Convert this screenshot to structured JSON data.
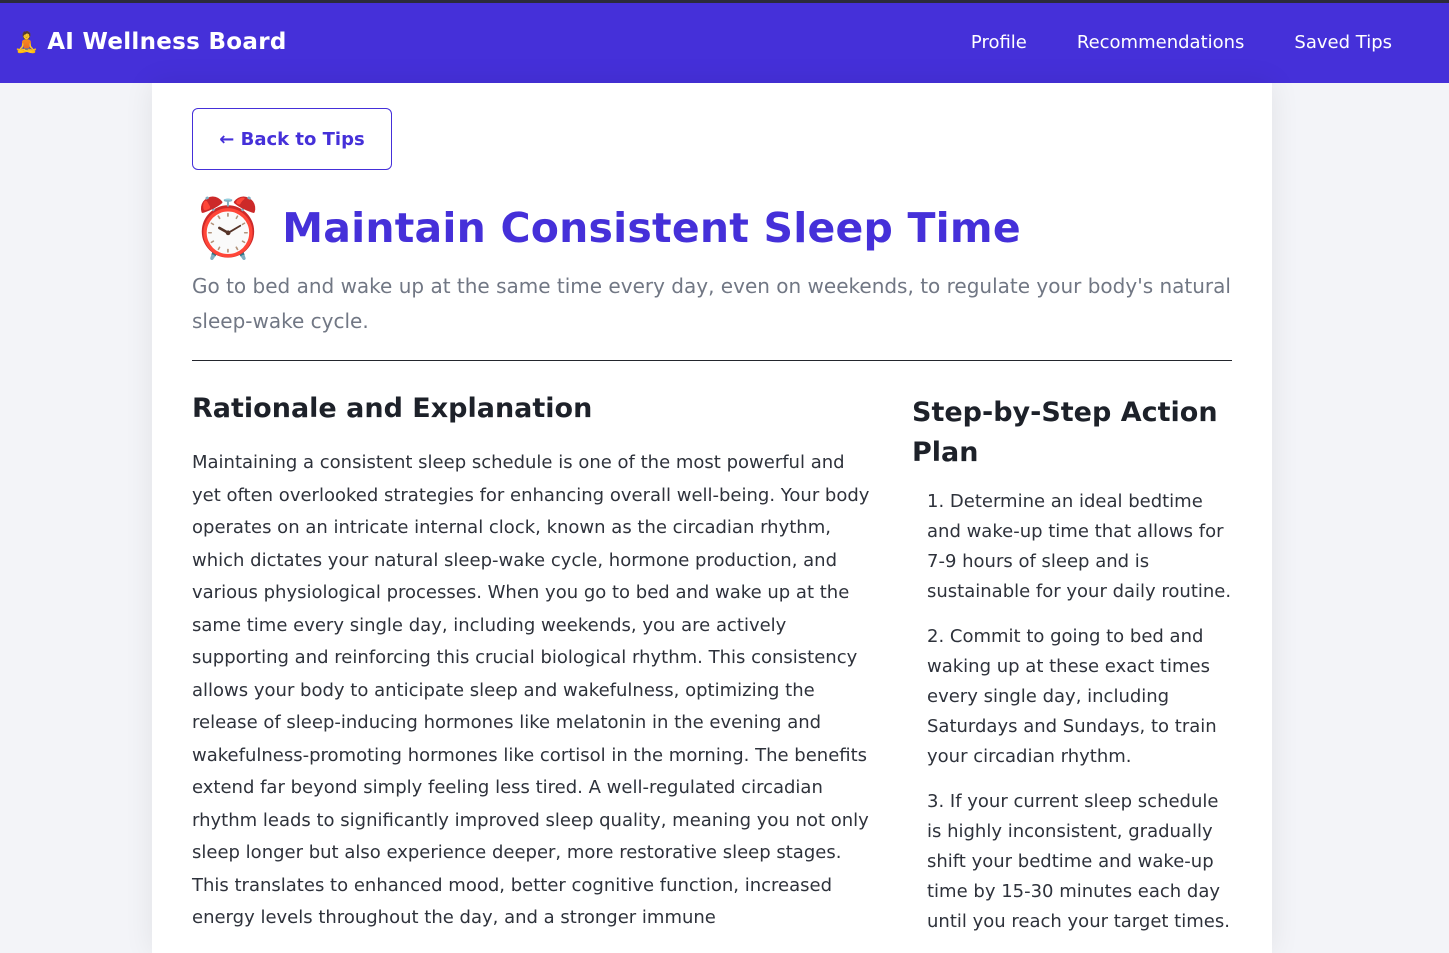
{
  "navbar": {
    "brand_icon": "🧘",
    "brand_title": "AI Wellness Board",
    "links": [
      "Profile",
      "Recommendations",
      "Saved Tips"
    ]
  },
  "back_button_label": "← Back to Tips",
  "tip": {
    "icon": "⏰",
    "title": "Maintain Consistent Sleep Time",
    "subtitle": "Go to bed and wake up at the same time every day, even on weekends, to regulate your body's natural sleep-wake cycle."
  },
  "rationale": {
    "heading": "Rationale and Explanation",
    "body": "Maintaining a consistent sleep schedule is one of the most powerful and yet often overlooked strategies for enhancing overall well-being. Your body operates on an intricate internal clock, known as the circadian rhythm, which dictates your natural sleep-wake cycle, hormone production, and various physiological processes. When you go to bed and wake up at the same time every single day, including weekends, you are actively supporting and reinforcing this crucial biological rhythm. This consistency allows your body to anticipate sleep and wakefulness, optimizing the release of sleep-inducing hormones like melatonin in the evening and wakefulness-promoting hormones like cortisol in the morning. The benefits extend far beyond simply feeling less tired. A well-regulated circadian rhythm leads to significantly improved sleep quality, meaning you not only sleep longer but also experience deeper, more restorative sleep stages. This translates to enhanced mood, better cognitive function, increased energy levels throughout the day, and a stronger immune"
  },
  "action_plan": {
    "heading": "Step-by-Step Action Plan",
    "steps": [
      "1. Determine an ideal bedtime and wake-up time that allows for 7-9 hours of sleep and is sustainable for your daily routine.",
      "2. Commit to going to bed and waking up at these exact times every single day, including Saturdays and Sundays, to train your circadian rhythm.",
      "3. If your current sleep schedule is highly inconsistent, gradually shift your bedtime and wake-up time by 15-30 minutes each day until you reach your target times."
    ]
  }
}
